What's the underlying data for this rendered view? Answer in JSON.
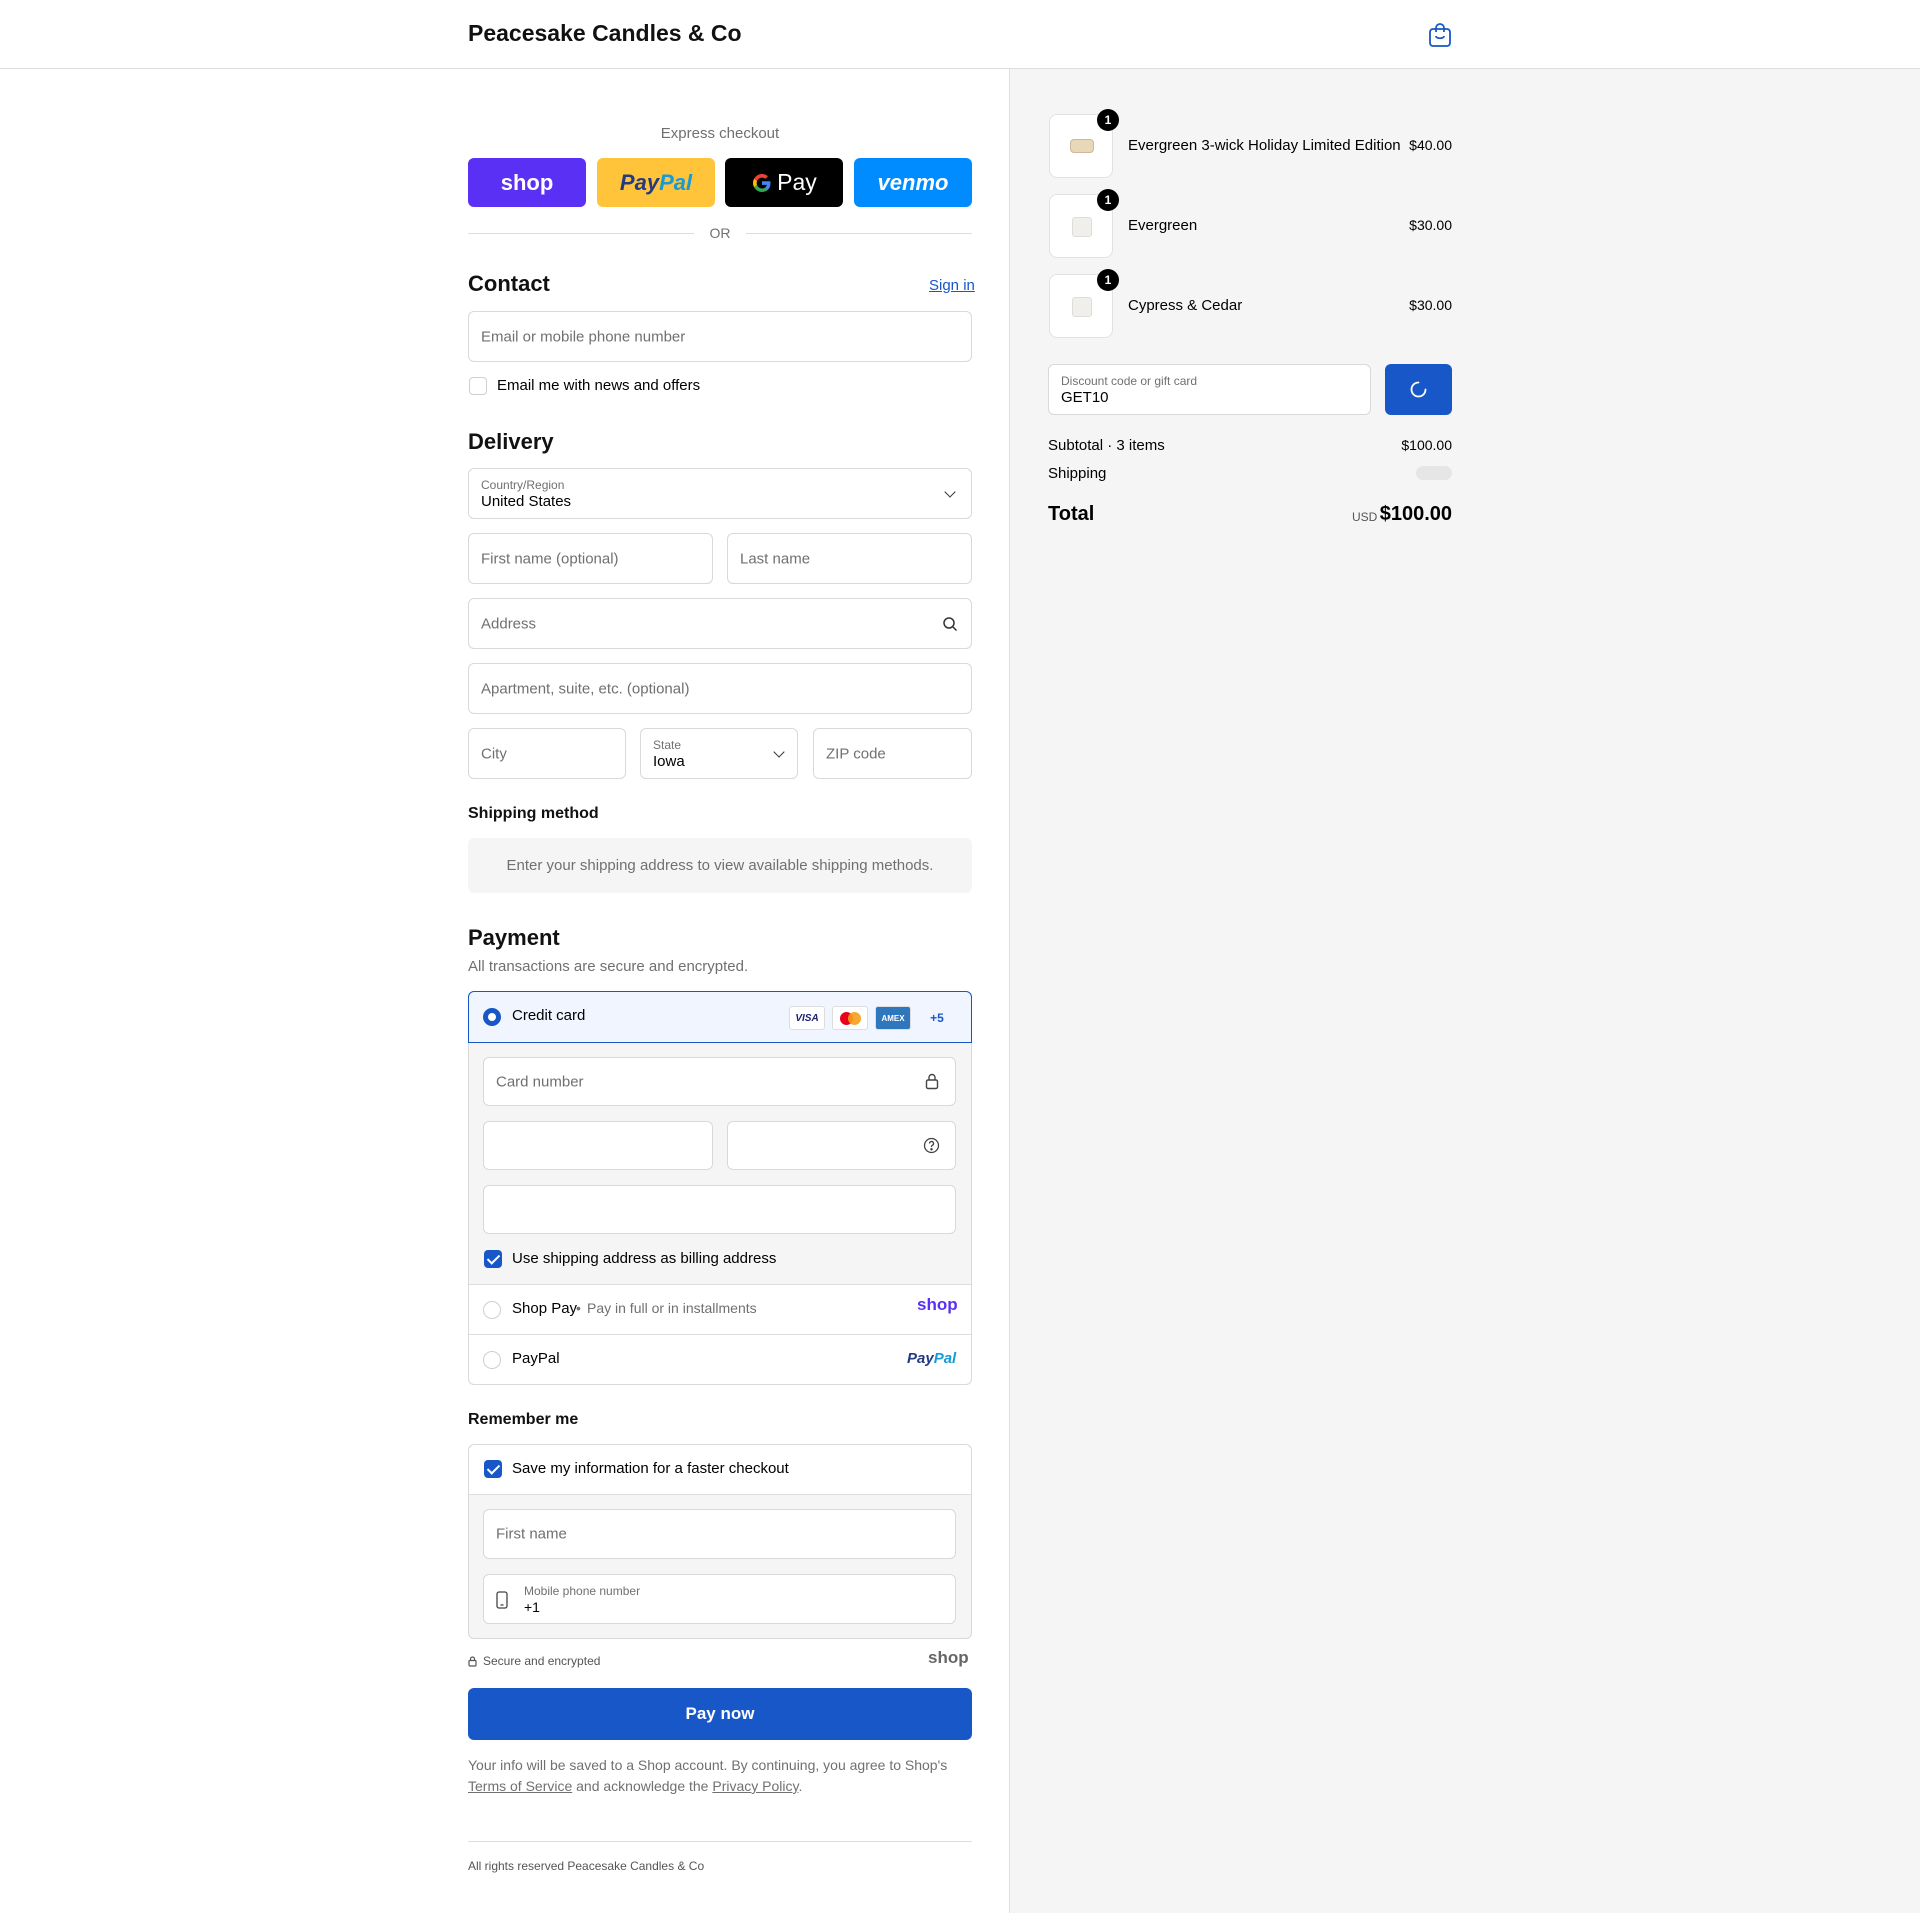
{
  "header": {
    "brand": "Peacesake Candles & Co"
  },
  "express": {
    "title": "Express checkout",
    "shop_label": "shop",
    "paypal_pay": "Pay",
    "paypal_pal": "Pal",
    "gpay_label": "Pay",
    "venmo_label": "venmo",
    "or_label": "OR"
  },
  "contact": {
    "title": "Contact",
    "sign_in": "Sign in",
    "email_placeholder": "Email or mobile phone number",
    "newsletter_label": "Email me with news and offers"
  },
  "delivery": {
    "title": "Delivery",
    "country_label": "Country/Region",
    "country_value": "United States",
    "first_name_placeholder": "First name (optional)",
    "last_name_placeholder": "Last name",
    "address_placeholder": "Address",
    "apartment_placeholder": "Apartment, suite, etc. (optional)",
    "city_placeholder": "City",
    "state_label": "State",
    "state_value": "Iowa",
    "zip_placeholder": "ZIP code"
  },
  "shipping": {
    "title": "Shipping method",
    "notice": "Enter your shipping address to view available shipping methods."
  },
  "payment": {
    "title": "Payment",
    "subtitle": "All transactions are secure and encrypted.",
    "credit_card_label": "Credit card",
    "card_logos": [
      "VISA",
      "AMEX",
      "+5"
    ],
    "card_number_placeholder": "Card number",
    "billing_label": "Use shipping address as billing address",
    "shop_pay_label": "Shop Pay",
    "shop_pay_sub": "Pay in full or in installments",
    "shop_pay_logo": "shop",
    "paypal_label": "PayPal",
    "paypal_logo_pay": "Pay",
    "paypal_logo_pal": "Pal"
  },
  "remember": {
    "title": "Remember me",
    "save_label": "Save my information for a faster checkout",
    "first_name_placeholder": "First name",
    "mobile_label": "Mobile phone number",
    "mobile_value": "+1",
    "secure_label": "Secure and encrypted",
    "shop_logo": "shop"
  },
  "pay_button": "Pay now",
  "legal": {
    "text1": "Your info will be saved to a Shop account. By continuing, you agree to Shop's",
    "terms": "Terms of Service",
    "and": "and acknowledge the",
    "privacy": "Privacy Policy",
    "period": "."
  },
  "footer": "All rights reserved Peacesake Candles & Co",
  "summary": {
    "items": [
      {
        "name": "Evergreen 3-wick Holiday Limited Edition",
        "price": "$40.00",
        "qty": "1"
      },
      {
        "name": "Evergreen",
        "price": "$30.00",
        "qty": "1"
      },
      {
        "name": "Cypress & Cedar",
        "price": "$30.00",
        "qty": "1"
      }
    ],
    "discount_label": "Discount code or gift card",
    "discount_value": "GET10",
    "subtotal_label": "Subtotal · 3 items",
    "subtotal_value": "$100.00",
    "shipping_label": "Shipping",
    "total_label": "Total",
    "currency": "USD",
    "total_value": "$100.00"
  },
  "colors": {
    "accent": "#1857c7",
    "shop_purple": "#5a31f4",
    "paypal_yellow": "#ffc439",
    "venmo_blue": "#008cff"
  }
}
